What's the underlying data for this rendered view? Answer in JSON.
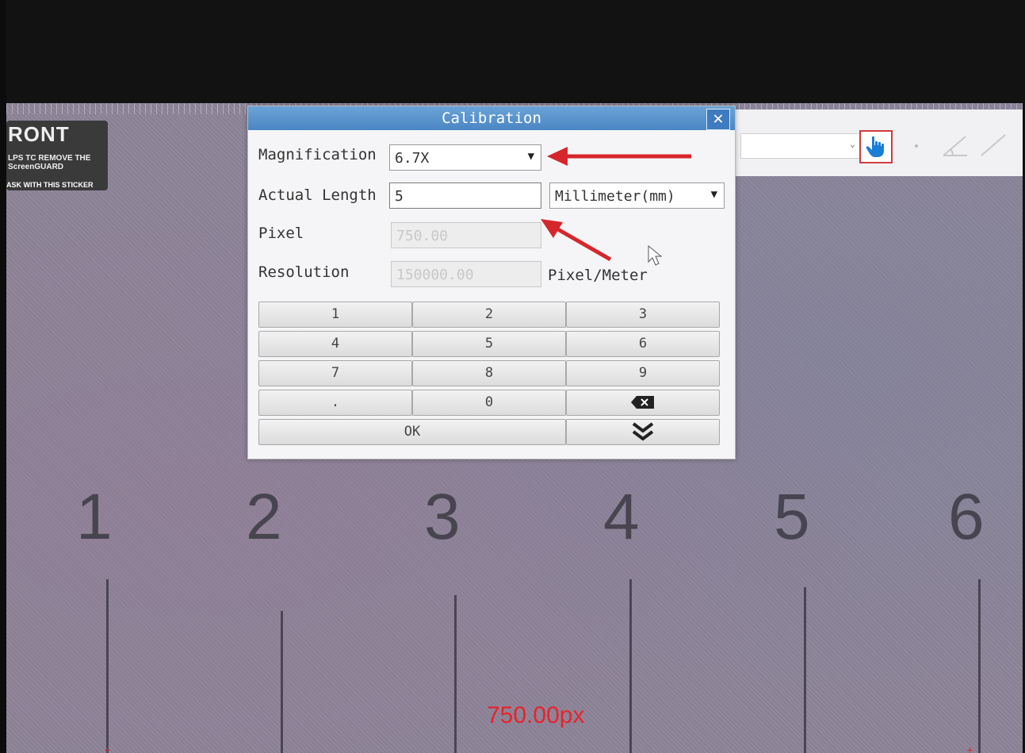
{
  "sticker": {
    "line1": "RONT",
    "line2": "LPS TC REMOVE THE ScreenGUARD",
    "line3": "ASK WITH THIS STICKER"
  },
  "toolbar": {
    "combo_value": "",
    "hand_icon": "hand-pointer-icon",
    "accent_color": "#1a7fd4"
  },
  "dialog": {
    "title": "Calibration",
    "close_label": "✕",
    "magnification": {
      "label": "Magnification",
      "value": "6.7X"
    },
    "actual_length": {
      "label": "Actual Length",
      "value": "5"
    },
    "unit": {
      "value": "Millimeter(mm)"
    },
    "pixel": {
      "label": "Pixel",
      "value": "750.00"
    },
    "resolution": {
      "label": "Resolution",
      "value": "150000.00",
      "unit": "Pixel/Meter"
    },
    "keypad": {
      "k1": "1",
      "k2": "2",
      "k3": "3",
      "k4": "4",
      "k5": "5",
      "k6": "6",
      "k7": "7",
      "k8": "8",
      "k9": "9",
      "kdot": ".",
      "k0": "0",
      "ok": "OK"
    }
  },
  "scale": {
    "n1": "1",
    "n2": "2",
    "n3": "3",
    "n4": "4",
    "n5": "5",
    "n6": "6"
  },
  "measurement": {
    "readout": "750.00px",
    "color": "#e8232a"
  },
  "annotation_color": "#d6262b"
}
